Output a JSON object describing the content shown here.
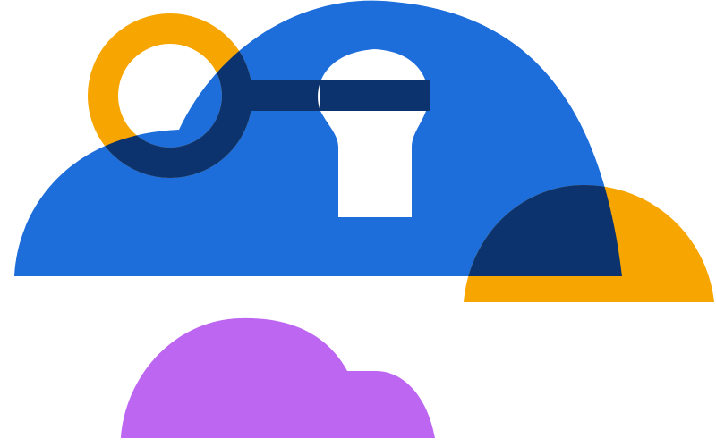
{
  "illustration": {
    "colors": {
      "background": "#ffffff",
      "cloud_blue": "#1d6ddb",
      "overlap_navy": "#0c336e",
      "key_orange": "#f7a500",
      "small_cloud_purple": "#bd66f2",
      "keyhole_white": "#ffffff"
    },
    "elements": [
      "large-blue-cloud",
      "keyhole",
      "key-ring",
      "key-shaft",
      "orange-half-circle",
      "purple-cloud"
    ]
  }
}
